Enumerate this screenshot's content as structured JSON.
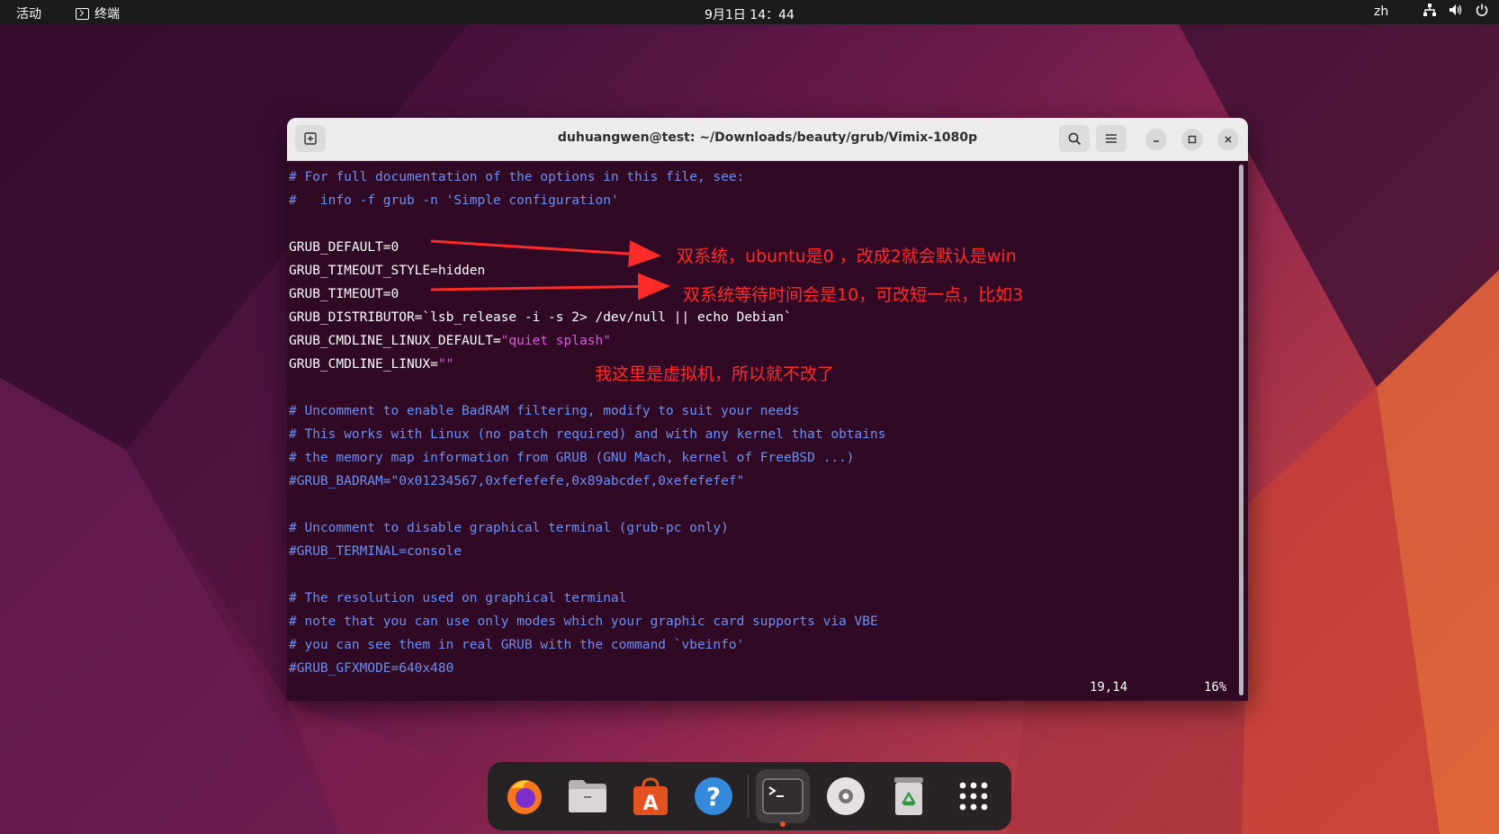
{
  "topbar": {
    "activities": "活动",
    "app_name": "终端",
    "clock": "9月1日 14：44",
    "lang": "zh"
  },
  "window": {
    "title": "duhuangwen@test: ~/Downloads/beauty/grub/Vimix-1080p"
  },
  "editor": {
    "lines": [
      "# For full documentation of the options in this file, see:",
      "#   info -f grub -n 'Simple configuration'",
      "",
      "GRUB_DEFAULT=0",
      "GRUB_TIMEOUT_STYLE=hidden",
      "GRUB_TIMEOUT=0",
      "GRUB_DISTRIBUTOR=`lsb_release -i -s 2> /dev/null || echo Debian`",
      "GRUB_CMDLINE_LINUX_DEFAULT=",
      "GRUB_CMDLINE_LINUX=",
      "",
      "# Uncomment to enable BadRAM filtering, modify to suit your needs",
      "# This works with Linux (no patch required) and with any kernel that obtains",
      "# the memory map information from GRUB (GNU Mach, kernel of FreeBSD ...)",
      "#GRUB_BADRAM=\"0x01234567,0xfefefefe,0x89abcdef,0xefefefef\"",
      "",
      "# Uncomment to disable graphical terminal (grub-pc only)",
      "#GRUB_TERMINAL=console",
      "",
      "# The resolution used on graphical terminal",
      "# note that you can use only modes which your graphic card supports via VBE",
      "# you can see them in real GRUB with the command `vbeinfo'",
      "#GRUB_GFXMODE=640x480"
    ],
    "cmdline_default_value": "\"quiet splash\"",
    "cmdline_value": "\"\"",
    "cursor_position": "19,14",
    "scroll_percent": "16%"
  },
  "annotations": {
    "note1": "双系统，ubuntu是0 ，改成2就会默认是win",
    "note2": "双系统等待时间会是10，可改短一点，比如3",
    "note3": "我这里是虚拟机，所以就不改了",
    "color": "#ff2a2a"
  },
  "dock": {
    "apps": [
      "firefox-icon",
      "files-icon",
      "app-center-icon",
      "help-icon",
      "terminal-icon",
      "disc-icon",
      "trash-icon",
      "show-apps-icon"
    ]
  },
  "colors": {
    "terminal_bg": "#300a24",
    "comment": "#6b8ff5",
    "string": "#d65dd6",
    "accent": "#e95420"
  }
}
